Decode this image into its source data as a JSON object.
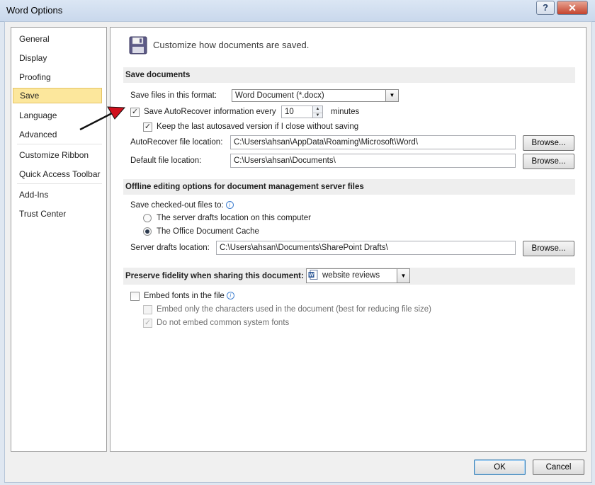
{
  "window": {
    "title": "Word Options",
    "help_glyph": "?",
    "close_glyph": "✕"
  },
  "sidebar": {
    "items": [
      {
        "label": "General"
      },
      {
        "label": "Display"
      },
      {
        "label": "Proofing"
      },
      {
        "label": "Save",
        "selected": true
      },
      {
        "label": "Language"
      },
      {
        "label": "Advanced"
      },
      {
        "label": "Customize Ribbon"
      },
      {
        "label": "Quick Access Toolbar"
      },
      {
        "label": "Add-Ins"
      },
      {
        "label": "Trust Center"
      }
    ]
  },
  "header": {
    "text": "Customize how documents are saved.",
    "icon": "floppy-disk-icon"
  },
  "save_documents": {
    "title": "Save documents",
    "format_label": "Save files in this format:",
    "format_value": "Word Document (*.docx)",
    "autorecover_label": "Save AutoRecover information every",
    "autorecover_checked": true,
    "autorecover_minutes": "10",
    "minutes_label": "minutes",
    "keep_last_label": "Keep the last autosaved version if I close without saving",
    "keep_last_checked": true,
    "autorecover_location_label": "AutoRecover file location:",
    "autorecover_location_value": "C:\\Users\\ahsan\\AppData\\Roaming\\Microsoft\\Word\\",
    "default_location_label": "Default file location:",
    "default_location_value": "C:\\Users\\ahsan\\Documents\\",
    "browse_label": "Browse..."
  },
  "offline": {
    "title": "Offline editing options for document management server files",
    "save_checked_out_label": "Save checked-out files to:",
    "option_server": "The server drafts location on this computer",
    "option_cache": "The Office Document Cache",
    "selected_option": "cache",
    "server_drafts_label": "Server drafts location:",
    "server_drafts_value": "C:\\Users\\ahsan\\Documents\\SharePoint Drafts\\",
    "browse_label": "Browse..."
  },
  "fidelity": {
    "title": "Preserve fidelity when sharing this document:",
    "document_value": "website reviews",
    "embed_fonts_label": "Embed fonts in the file",
    "embed_fonts_checked": false,
    "embed_only_label": "Embed only the characters used in the document (best for reducing file size)",
    "embed_only_checked": false,
    "no_common_label": "Do not embed common system fonts",
    "no_common_checked": true
  },
  "footer": {
    "ok_label": "OK",
    "cancel_label": "Cancel"
  },
  "colors": {
    "selected_nav": "#fce79c",
    "section_header": "#eeeeee",
    "annotation_arrow": "#d0101c"
  }
}
